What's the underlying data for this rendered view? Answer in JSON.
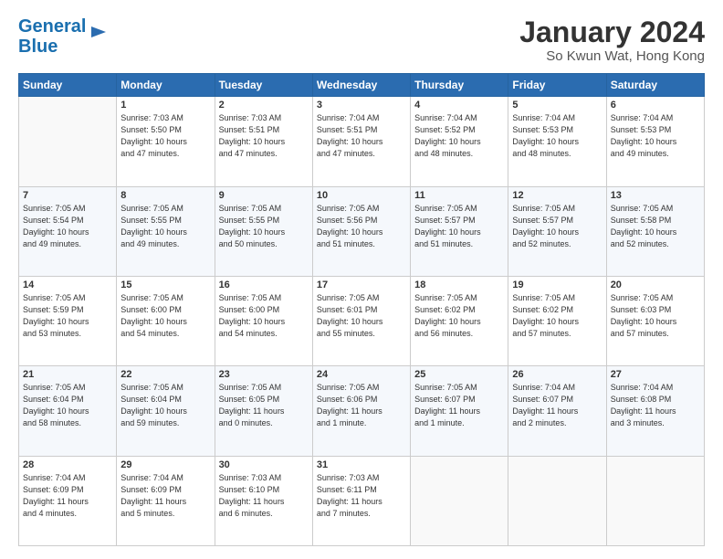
{
  "header": {
    "logo_line1": "General",
    "logo_line2": "Blue",
    "title": "January 2024",
    "subtitle": "So Kwun Wat, Hong Kong"
  },
  "weekdays": [
    "Sunday",
    "Monday",
    "Tuesday",
    "Wednesday",
    "Thursday",
    "Friday",
    "Saturday"
  ],
  "weeks": [
    [
      {
        "day": "",
        "info": ""
      },
      {
        "day": "1",
        "info": "Sunrise: 7:03 AM\nSunset: 5:50 PM\nDaylight: 10 hours\nand 47 minutes."
      },
      {
        "day": "2",
        "info": "Sunrise: 7:03 AM\nSunset: 5:51 PM\nDaylight: 10 hours\nand 47 minutes."
      },
      {
        "day": "3",
        "info": "Sunrise: 7:04 AM\nSunset: 5:51 PM\nDaylight: 10 hours\nand 47 minutes."
      },
      {
        "day": "4",
        "info": "Sunrise: 7:04 AM\nSunset: 5:52 PM\nDaylight: 10 hours\nand 48 minutes."
      },
      {
        "day": "5",
        "info": "Sunrise: 7:04 AM\nSunset: 5:53 PM\nDaylight: 10 hours\nand 48 minutes."
      },
      {
        "day": "6",
        "info": "Sunrise: 7:04 AM\nSunset: 5:53 PM\nDaylight: 10 hours\nand 49 minutes."
      }
    ],
    [
      {
        "day": "7",
        "info": "Sunrise: 7:05 AM\nSunset: 5:54 PM\nDaylight: 10 hours\nand 49 minutes."
      },
      {
        "day": "8",
        "info": "Sunrise: 7:05 AM\nSunset: 5:55 PM\nDaylight: 10 hours\nand 49 minutes."
      },
      {
        "day": "9",
        "info": "Sunrise: 7:05 AM\nSunset: 5:55 PM\nDaylight: 10 hours\nand 50 minutes."
      },
      {
        "day": "10",
        "info": "Sunrise: 7:05 AM\nSunset: 5:56 PM\nDaylight: 10 hours\nand 51 minutes."
      },
      {
        "day": "11",
        "info": "Sunrise: 7:05 AM\nSunset: 5:57 PM\nDaylight: 10 hours\nand 51 minutes."
      },
      {
        "day": "12",
        "info": "Sunrise: 7:05 AM\nSunset: 5:57 PM\nDaylight: 10 hours\nand 52 minutes."
      },
      {
        "day": "13",
        "info": "Sunrise: 7:05 AM\nSunset: 5:58 PM\nDaylight: 10 hours\nand 52 minutes."
      }
    ],
    [
      {
        "day": "14",
        "info": "Sunrise: 7:05 AM\nSunset: 5:59 PM\nDaylight: 10 hours\nand 53 minutes."
      },
      {
        "day": "15",
        "info": "Sunrise: 7:05 AM\nSunset: 6:00 PM\nDaylight: 10 hours\nand 54 minutes."
      },
      {
        "day": "16",
        "info": "Sunrise: 7:05 AM\nSunset: 6:00 PM\nDaylight: 10 hours\nand 54 minutes."
      },
      {
        "day": "17",
        "info": "Sunrise: 7:05 AM\nSunset: 6:01 PM\nDaylight: 10 hours\nand 55 minutes."
      },
      {
        "day": "18",
        "info": "Sunrise: 7:05 AM\nSunset: 6:02 PM\nDaylight: 10 hours\nand 56 minutes."
      },
      {
        "day": "19",
        "info": "Sunrise: 7:05 AM\nSunset: 6:02 PM\nDaylight: 10 hours\nand 57 minutes."
      },
      {
        "day": "20",
        "info": "Sunrise: 7:05 AM\nSunset: 6:03 PM\nDaylight: 10 hours\nand 57 minutes."
      }
    ],
    [
      {
        "day": "21",
        "info": "Sunrise: 7:05 AM\nSunset: 6:04 PM\nDaylight: 10 hours\nand 58 minutes."
      },
      {
        "day": "22",
        "info": "Sunrise: 7:05 AM\nSunset: 6:04 PM\nDaylight: 10 hours\nand 59 minutes."
      },
      {
        "day": "23",
        "info": "Sunrise: 7:05 AM\nSunset: 6:05 PM\nDaylight: 11 hours\nand 0 minutes."
      },
      {
        "day": "24",
        "info": "Sunrise: 7:05 AM\nSunset: 6:06 PM\nDaylight: 11 hours\nand 1 minute."
      },
      {
        "day": "25",
        "info": "Sunrise: 7:05 AM\nSunset: 6:07 PM\nDaylight: 11 hours\nand 1 minute."
      },
      {
        "day": "26",
        "info": "Sunrise: 7:04 AM\nSunset: 6:07 PM\nDaylight: 11 hours\nand 2 minutes."
      },
      {
        "day": "27",
        "info": "Sunrise: 7:04 AM\nSunset: 6:08 PM\nDaylight: 11 hours\nand 3 minutes."
      }
    ],
    [
      {
        "day": "28",
        "info": "Sunrise: 7:04 AM\nSunset: 6:09 PM\nDaylight: 11 hours\nand 4 minutes."
      },
      {
        "day": "29",
        "info": "Sunrise: 7:04 AM\nSunset: 6:09 PM\nDaylight: 11 hours\nand 5 minutes."
      },
      {
        "day": "30",
        "info": "Sunrise: 7:03 AM\nSunset: 6:10 PM\nDaylight: 11 hours\nand 6 minutes."
      },
      {
        "day": "31",
        "info": "Sunrise: 7:03 AM\nSunset: 6:11 PM\nDaylight: 11 hours\nand 7 minutes."
      },
      {
        "day": "",
        "info": ""
      },
      {
        "day": "",
        "info": ""
      },
      {
        "day": "",
        "info": ""
      }
    ]
  ]
}
